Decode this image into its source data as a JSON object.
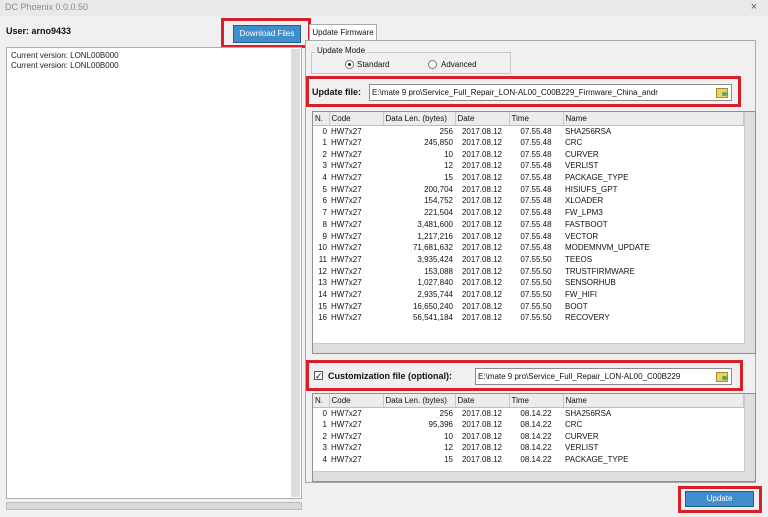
{
  "window": {
    "title": "DC Phoenix 0.0.0.50",
    "close_glyph": "×"
  },
  "user": {
    "label": "User: arno9433"
  },
  "toolbar": {
    "download_label": "Download Files"
  },
  "log": {
    "lines": [
      "Current version: LONL00B000",
      "Current version: LONL00B000"
    ]
  },
  "tabs": {
    "update_firmware": "Update Firmware"
  },
  "update_mode": {
    "label": "Update Mode",
    "standard_label": "Standard",
    "advanced_label": "Advanced",
    "selected": "Standard"
  },
  "update_file": {
    "label": "Update file:",
    "value": "E:\\mate 9 pro\\Service_Full_Repair_LON-AL00_C00B229_Firmware_China_andr"
  },
  "customization": {
    "checked": true,
    "label": "Customization file (optional):",
    "value": "E:\\mate 9 pro\\Service_Full_Repair_LON-AL00_C00B229"
  },
  "table_headers": [
    "N.",
    "Code",
    "Data Len. (bytes)",
    "Date",
    "Time",
    "Name"
  ],
  "update_rows": [
    [
      "0",
      "HW7x27",
      "256",
      "2017.08.12",
      "07.55.48",
      "SHA256RSA"
    ],
    [
      "1",
      "HW7x27",
      "245,850",
      "2017.08.12",
      "07.55.48",
      "CRC"
    ],
    [
      "2",
      "HW7x27",
      "10",
      "2017.08.12",
      "07.55.48",
      "CURVER"
    ],
    [
      "3",
      "HW7x27",
      "12",
      "2017.08.12",
      "07.55.48",
      "VERLIST"
    ],
    [
      "4",
      "HW7x27",
      "15",
      "2017.08.12",
      "07.55.48",
      "PACKAGE_TYPE"
    ],
    [
      "5",
      "HW7x27",
      "200,704",
      "2017.08.12",
      "07.55.48",
      "HISIUFS_GPT"
    ],
    [
      "6",
      "HW7x27",
      "154,752",
      "2017.08.12",
      "07.55.48",
      "XLOADER"
    ],
    [
      "7",
      "HW7x27",
      "221,504",
      "2017.08.12",
      "07.55.48",
      "FW_LPM3"
    ],
    [
      "8",
      "HW7x27",
      "3,481,600",
      "2017.08.12",
      "07.55.48",
      "FASTBOOT"
    ],
    [
      "9",
      "HW7x27",
      "1,217,216",
      "2017.08.12",
      "07.55.48",
      "VECTOR"
    ],
    [
      "10",
      "HW7x27",
      "71,681,632",
      "2017.08.12",
      "07.55.48",
      "MODEMNVM_UPDATE"
    ],
    [
      "11",
      "HW7x27",
      "3,935,424",
      "2017.08.12",
      "07.55.50",
      "TEEOS"
    ],
    [
      "12",
      "HW7x27",
      "153,088",
      "2017.08.12",
      "07.55.50",
      "TRUSTFIRMWARE"
    ],
    [
      "13",
      "HW7x27",
      "1,027,840",
      "2017.08.12",
      "07.55.50",
      "SENSORHUB"
    ],
    [
      "14",
      "HW7x27",
      "2,935,744",
      "2017.08.12",
      "07.55.50",
      "FW_HIFI"
    ],
    [
      "15",
      "HW7x27",
      "16,650,240",
      "2017.08.12",
      "07.55.50",
      "BOOT"
    ],
    [
      "16",
      "HW7x27",
      "56,541,184",
      "2017.08.12",
      "07.55.50",
      "RECOVERY"
    ]
  ],
  "custom_rows": [
    [
      "0",
      "HW7x27",
      "256",
      "2017.08.12",
      "08.14.22",
      "SHA256RSA"
    ],
    [
      "1",
      "HW7x27",
      "95,396",
      "2017.08.12",
      "08.14.22",
      "CRC"
    ],
    [
      "2",
      "HW7x27",
      "10",
      "2017.08.12",
      "08.14.22",
      "CURVER"
    ],
    [
      "3",
      "HW7x27",
      "12",
      "2017.08.12",
      "08.14.22",
      "VERLIST"
    ],
    [
      "4",
      "HW7x27",
      "15",
      "2017.08.12",
      "08.14.22",
      "PACKAGE_TYPE"
    ]
  ],
  "actions": {
    "update_label": "Update"
  },
  "colors": {
    "accent_button": "#3f8ec9",
    "highlight_border": "#d72027"
  }
}
